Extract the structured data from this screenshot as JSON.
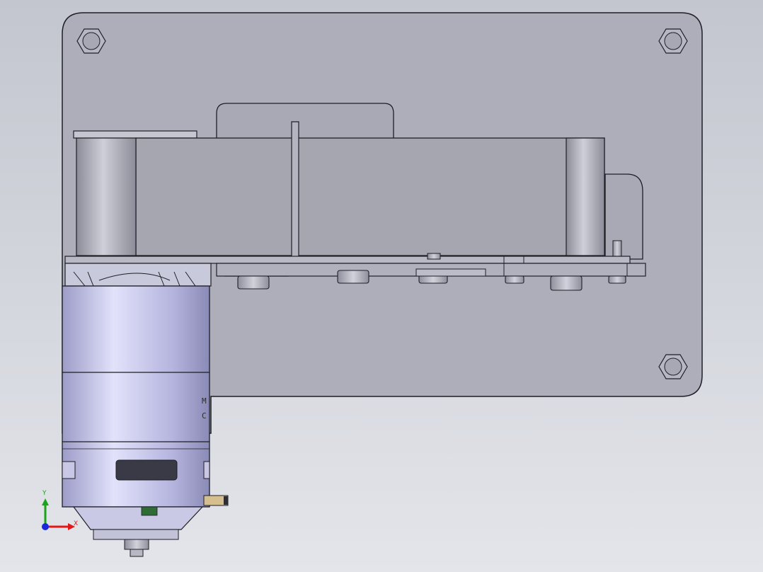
{
  "viewport": {
    "background_top": "#c3c6cf",
    "background_bottom": "#e3e5ea"
  },
  "colors": {
    "plate": "#aeaeba",
    "edge": "#1e1e24",
    "belt": "#a6a6b0",
    "tab": "#a9a9b5",
    "pulley_light": "#c6c6d0",
    "pulley_dark": "#8c8c98",
    "motor_light": "#dcdcf6",
    "motor_mid": "#b4b4de",
    "motor_dark": "#8a8ab6",
    "connector": "#d6bf8f",
    "marker": "#2f6b35",
    "axis_x": "#e01818",
    "axis_y": "#1aa41a",
    "axis_z": "#1a2ad8"
  },
  "motor_label": {
    "line1": "M",
    "line2": "C"
  },
  "triad": {
    "x_label": "X",
    "y_label": "Y"
  }
}
